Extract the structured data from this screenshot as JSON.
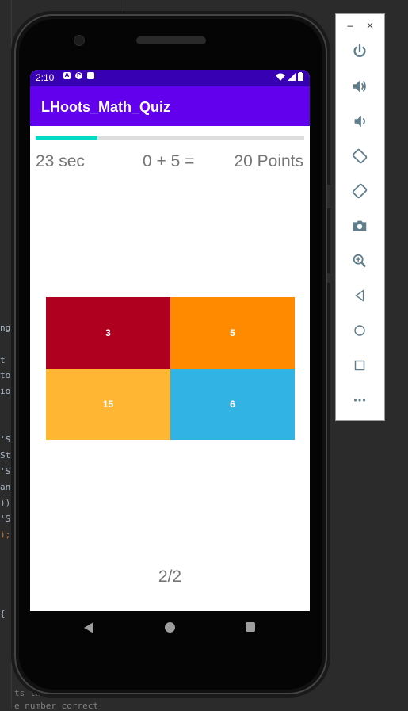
{
  "status_bar": {
    "time": "2:10",
    "left_icons": [
      "A",
      "P",
      "SD"
    ]
  },
  "app": {
    "title": "LHoots_Math_Quiz"
  },
  "quiz": {
    "progress": 0.23,
    "timer": "23 sec",
    "question": "0 + 5 =",
    "points": "20 Points",
    "answers": [
      {
        "label": "3",
        "color": "#b00020"
      },
      {
        "label": "5",
        "color": "#ff8a00"
      },
      {
        "label": "15",
        "color": "#ffb733"
      },
      {
        "label": "6",
        "color": "#31b4e4"
      }
    ],
    "page": "2/2"
  },
  "colors": {
    "status_bar": "#3700b3",
    "app_bar": "#6200ee",
    "accent": "#03dac5"
  },
  "ide_fragments": {
    "l1": "ng",
    "l2": "t",
    "l3": "ton",
    "l4": "ion",
    "l5": "'St",
    "l6": "Sto",
    "l7": "'St",
    "l8": "ans",
    "l9": "))",
    "l10": "'St",
    "l11": "); ",
    "l12": "{",
    "b1": "ts the se",
    "b2": "e number correct"
  },
  "toolbar_icons": [
    "power-icon",
    "volume-up-icon",
    "volume-down-icon",
    "rotate-left-icon",
    "rotate-right-icon",
    "camera-icon",
    "zoom-icon",
    "back-icon",
    "home-icon",
    "overview-icon",
    "more-icon"
  ]
}
